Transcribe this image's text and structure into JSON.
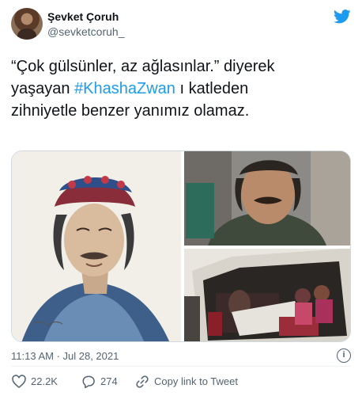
{
  "author": {
    "name": "Şevket Çoruh",
    "handle": "@sevketcoruh_"
  },
  "tweet": {
    "line1": "“Çok gülsünler, az ağlasınlar.” diyerek",
    "line2_before": "yaşayan ",
    "hashtag": "#KhashaZwan",
    "line2_after": " ı katleden",
    "line3": "zihniyetle benzer yanımız olamaz."
  },
  "meta": {
    "time": "11:13 AM · Jul 28, 2021"
  },
  "actions": {
    "likes": "22.2K",
    "replies": "274",
    "copy_link": "Copy link to Tweet"
  },
  "colors": {
    "accent": "#1d9bf0",
    "like": "#f91880",
    "secondary_text": "#536471"
  }
}
